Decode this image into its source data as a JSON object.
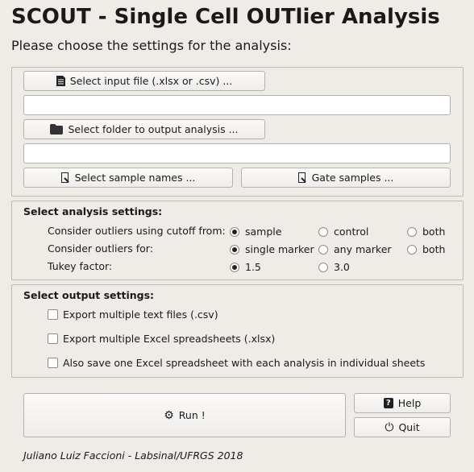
{
  "title": "SCOUT - Single Cell OUTlier Analysis",
  "subtitle": "Please choose the settings for the analysis:",
  "files": {
    "input_button": "Select input file (.xlsx or .csv) ...",
    "input_value": "",
    "output_button": "Select folder to output analysis ...",
    "output_value": "",
    "sample_names_button": "Select sample names ...",
    "gate_button": "Gate samples ..."
  },
  "analysis": {
    "title": "Select analysis settings:",
    "rows": [
      {
        "label": "Consider outliers using cutoff from:",
        "options": [
          "sample",
          "control",
          "both"
        ],
        "selected": "sample"
      },
      {
        "label": "Consider outliers for:",
        "options": [
          "single marker",
          "any marker",
          "both"
        ],
        "selected": "single marker"
      },
      {
        "label": "Tukey factor:",
        "options": [
          "1.5",
          "3.0"
        ],
        "selected": "1.5"
      }
    ]
  },
  "output": {
    "title": "Select output settings:",
    "options": [
      {
        "label": "Export multiple text files (.csv)",
        "checked": false
      },
      {
        "label": "Export multiple Excel spreadsheets (.xlsx)",
        "checked": false
      },
      {
        "label": "Also save one Excel spreadsheet with each analysis in individual sheets",
        "checked": false
      }
    ]
  },
  "actions": {
    "run": "Run !",
    "help": "Help",
    "quit": "Quit"
  },
  "footer": "Juliano Luiz Faccioni - Labsinal/UFRGS 2018"
}
